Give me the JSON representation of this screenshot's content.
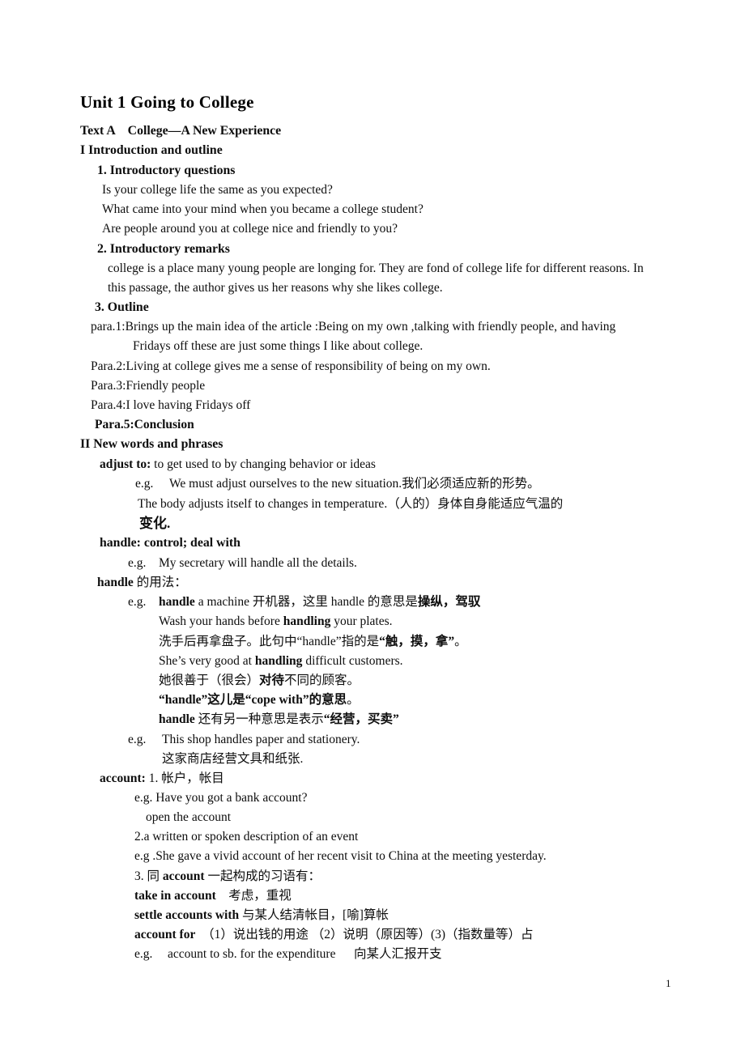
{
  "document": {
    "title": "Unit 1    Going to College",
    "page_number": "1",
    "text_color": "#0d0d0d",
    "background_color": "#ffffff"
  },
  "lines": [
    {
      "id": "text_a",
      "text": "Text A    College—A New Experience"
    },
    {
      "id": "sec_1",
      "text": "I Introduction and outline"
    },
    {
      "id": "sub_1",
      "text": "1. Introductory questions"
    },
    {
      "id": "q1",
      "text": "Is your college life the same as you expected?"
    },
    {
      "id": "q2",
      "text": "What came into your mind when you became a college student?"
    },
    {
      "id": "q3",
      "text": "Are people around you at college nice and friendly to you?"
    },
    {
      "id": "sub_2",
      "text": "2. Introductory remarks"
    },
    {
      "id": "remarks_1",
      "text": "college is a place many young people are longing for. They are fond of college life for different reasons. In"
    },
    {
      "id": "remarks_2",
      "text": "this passage, the author gives us her reasons why she likes college."
    },
    {
      "id": "sub_3",
      "text": "3. Outline"
    },
    {
      "id": "para1_a",
      "text": "para.1:Brings up the main idea of the article :Being on my own ,talking with friendly people, and having"
    },
    {
      "id": "para1_b",
      "text": "Fridays off these are just some things I like about college."
    },
    {
      "id": "para2",
      "text": "Para.2:Living at college gives me a sense of responsibility of being on my own."
    },
    {
      "id": "para3",
      "text": "Para.3:Friendly people"
    },
    {
      "id": "para4",
      "text": "Para.4:I love having Fridays off"
    },
    {
      "id": "para5",
      "text": "Para.5:Conclusion"
    },
    {
      "id": "sec_2",
      "text": "II New words and phrases"
    },
    {
      "id": "adjust_head_b",
      "text": "adjust to:"
    },
    {
      "id": "adjust_head_r",
      "text": " to get used to by changing behavior or ideas"
    },
    {
      "id": "adjust_eg_label",
      "text": "e.g."
    },
    {
      "id": "adjust_eg_1",
      "text": "We must adjust ourselves to the new situation.我们必须适应新的形势。"
    },
    {
      "id": "adjust_eg_2",
      "text": "The body adjusts itself to changes in temperature.（人的）身体自身能适应气温的"
    },
    {
      "id": "adjust_eg_3",
      "text": "变化."
    },
    {
      "id": "handle_head",
      "text": "handle: control; deal with"
    },
    {
      "id": "handle_eg1_label",
      "text": "e.g."
    },
    {
      "id": "handle_eg1_text",
      "text": "My secretary will handle all the details."
    },
    {
      "id": "handle_usage_b",
      "text": "handle"
    },
    {
      "id": "handle_usage_r",
      "text": " 的用法："
    },
    {
      "id": "handle_eg2_label",
      "text": "e.g."
    },
    {
      "id": "handle_m_b1",
      "text": "handle"
    },
    {
      "id": "handle_m_r1",
      "text": " a machine 开机器，这里 handle 的意思是"
    },
    {
      "id": "handle_m_b2",
      "text": "操纵，驾驭"
    },
    {
      "id": "handle_wash_r1",
      "text": "Wash your hands before "
    },
    {
      "id": "handle_wash_b",
      "text": "handling"
    },
    {
      "id": "handle_wash_r2",
      "text": " your plates."
    },
    {
      "id": "handle_cn_r1",
      "text": "洗手后再拿盘子。此句中“handle”指的是"
    },
    {
      "id": "handle_cn_b",
      "text": "“触，摸，拿”"
    },
    {
      "id": "handle_cn_r2",
      "text": "。"
    },
    {
      "id": "handle_she_r1",
      "text": "She’s very good at "
    },
    {
      "id": "handle_she_b",
      "text": "handling"
    },
    {
      "id": "handle_she_r2",
      "text": " difficult customers."
    },
    {
      "id": "handle_she_cn_r1",
      "text": "她很善于（很会）"
    },
    {
      "id": "handle_she_cn_b",
      "text": "对待"
    },
    {
      "id": "handle_she_cn_r2",
      "text": "不同的顾客。"
    },
    {
      "id": "handle_cope_b",
      "text": "“handle”这儿是“cope with”的意思"
    },
    {
      "id": "handle_cope_r",
      "text": "。"
    },
    {
      "id": "handle_trade_b1",
      "text": "handle"
    },
    {
      "id": "handle_trade_r",
      "text": " 还有另一种意思是表示"
    },
    {
      "id": "handle_trade_b2",
      "text": "“经营，买卖”"
    },
    {
      "id": "shop_eg_label",
      "text": "e.g."
    },
    {
      "id": "shop_eg_text",
      "text": "This shop handles paper and stationery."
    },
    {
      "id": "shop_eg_cn",
      "text": "这家商店经营文具和纸张."
    },
    {
      "id": "account_head_b",
      "text": "account:"
    },
    {
      "id": "account_head_r",
      "text": " 1. 帐户，帐目"
    },
    {
      "id": "account_eg1",
      "text": "e.g. Have you got a bank account?"
    },
    {
      "id": "account_open",
      "text": "open the account"
    },
    {
      "id": "account_def2",
      "text": "2.a written or spoken description of an event"
    },
    {
      "id": "account_eg2",
      "text": "e.g .She gave a vivid account of her recent visit to China at the meeting yesterday."
    },
    {
      "id": "account_idiom_r1",
      "text": "3. 同 "
    },
    {
      "id": "account_idiom_b1",
      "text": "account"
    },
    {
      "id": "account_idiom_r2",
      "text": " 一起构成的习语有："
    },
    {
      "id": "idiom1_b",
      "text": "take in account"
    },
    {
      "id": "idiom1_r",
      "text": "　考虑，重视"
    },
    {
      "id": "idiom2_b",
      "text": "settle accounts with"
    },
    {
      "id": "idiom2_r",
      "text": " 与某人结清帐目，[喻]算帐"
    },
    {
      "id": "idiom3_b",
      "text": "account for"
    },
    {
      "id": "idiom3_r",
      "text": "　（1）说出钱的用途 （2）说明（原因等）(3)（指数量等）占"
    },
    {
      "id": "idiom_eg_label",
      "text": "e.g."
    },
    {
      "id": "idiom_eg_text",
      "text": "account to sb. for the expenditure"
    },
    {
      "id": "idiom_eg_cn",
      "text": "向某人汇报开支"
    }
  ]
}
